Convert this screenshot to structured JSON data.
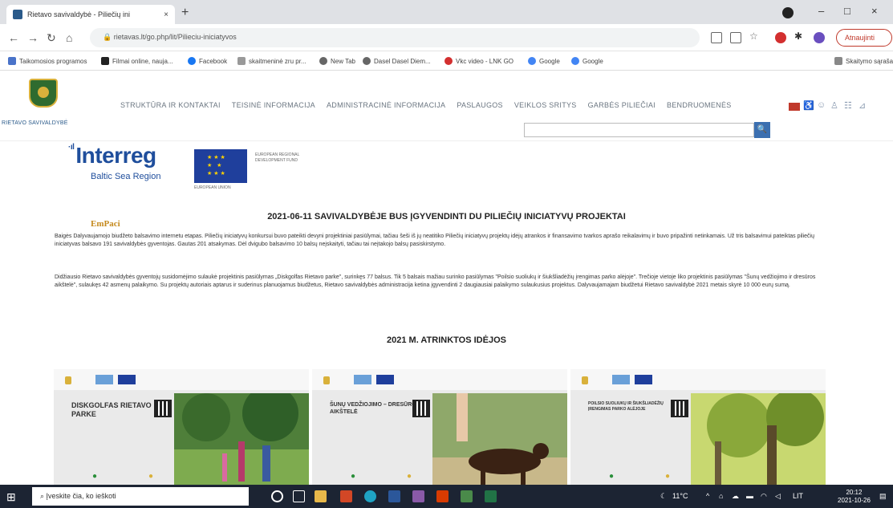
{
  "browser": {
    "tab_title": "Rietavo savivaldybė - Piliečių ini",
    "tab_close": "×",
    "new_tab": "+",
    "window_buttons": [
      "–",
      "□",
      "×"
    ],
    "url": "rietavas.lt/go.php/lit/Pilieciu-iniciatyvos",
    "update_label": "Atnaujinti",
    "bookmarks": [
      {
        "label": "Taikomosios programos",
        "icon": "apps-grid-icon",
        "color": "#4a73c9"
      },
      {
        "label": "Filmai online, nauja...",
        "icon": "film-icon",
        "color": "#222222"
      },
      {
        "label": "Facebook",
        "icon": "facebook-icon",
        "color": "#1877f2"
      },
      {
        "label": "skaitmeninė zru pr...",
        "icon": "search-icon",
        "color": "#888888"
      },
      {
        "label": "New Tab",
        "icon": "globe-icon",
        "color": "#666666"
      },
      {
        "label": "Dasel Dasel Diem...",
        "icon": "globe-icon",
        "color": "#666666"
      },
      {
        "label": "Vkc video - LNK GO",
        "icon": "play-icon",
        "color": "#d32f2f"
      },
      {
        "label": "Google",
        "icon": "google-icon",
        "color": "#4285f4"
      },
      {
        "label": "Google",
        "icon": "google-icon",
        "color": "#4285f4"
      }
    ],
    "reading_list": "Skaitymo sąrašas"
  },
  "site": {
    "brand": "RIETAVO SAVIVALDYBĖ",
    "menu": [
      "STRUKTŪRA IR KONTAKTAI",
      "TEISINĖ INFORMACIJA",
      "ADMINISTRACINĖ INFORMACIJA",
      "PASLAUGOS",
      "VEIKLOS SRITYS",
      "GARBĖS PILIEČIAI",
      "BENDRUOMENĖS"
    ],
    "search_button": "🔍"
  },
  "logos": {
    "interreg": "Interreg",
    "region": "Baltic Sea Region",
    "eu_text": "EUROPEAN REGIONAL DEVELOPMENT FUND",
    "eu_under": "EUROPEAN UNION",
    "empaci": "EmPaci"
  },
  "article": {
    "title": "2021-06-11 SAVIVALDYBĖJE BUS ĮGYVENDINTI DU PILIEČIŲ INICIATYVŲ PROJEKTAI",
    "para1": "Baigės Dalyvaujamojo biudžeto balsavimo internetu etapas. Piliečių iniciatyvų konkursui buvo pateikti devyni projektiniai pasiūlymai, tačiau šeši iš jų neatitiko Piliečių iniciatyvų projektų idėjų atrankos ir finansavimo tvarkos aprašo reikalavimų ir buvo pripažinti netinkamais. Už tris balsavimui pateiktas piliečių iniciatyvas balsavo 191 savivaldybės gyventojas. Gautas 201 atsakymas. Dėl dvigubo balsavimo 10 balsų neįskaityti, tačiau tai neįtakojo balsų pasiskirstymo.",
    "para2": "Didžiausio Rietavo savivaldybės gyventojų susidomėjimo sulaukė projektinis pasiūlymas „Diskgolfas Rietavo parke\", surinkęs 77 balsus. Tik 5 balsais mažiau surinko pasiūlymas \"Poilsio suoliukų ir šiukšliadėžių įrengimas parko alėjoje\". Trečioje vietoje liko projektinis pasiūlymas \"Šunų vedžiojimo ir dresūros aikštelė\", sulaukęs 42 asmenų palaikymo. Su projektų autoriais aptarus ir suderinus planuojamus biudžetus, Rietavo savivaldybės administracija ketina įgyvendinti 2 daugiausiai palaikymo sulaukusius projektus. Dalyvaujamajam biudžetui Rietavo savivaldybė 2021 metais skyrė 10 000 eurų sumą.",
    "section_title": "2021 M. ATRINKTOS IDĖJOS"
  },
  "cards": [
    {
      "title": "DISKGOLFAS RIETAVO PARKE",
      "photo_color": "#6f9a4a"
    },
    {
      "title": "ŠUNŲ VEDŽIOJIMO – DRESŪROS AIKŠTELĖ",
      "photo_color": "#8a6a3e"
    },
    {
      "title": "POILSIO SUOLIUKŲ IR ŠIUKŠLIADĖŽIŲ ĮRENGIMAS PARKO ALĖJOJE",
      "photo_color": "#9ab03e"
    }
  ],
  "taskbar": {
    "search_placeholder": "Įveskite čia, ko ieškoti",
    "weather": "11°C",
    "language": "LIT",
    "time": "20:12",
    "date": "2021-10-26"
  }
}
